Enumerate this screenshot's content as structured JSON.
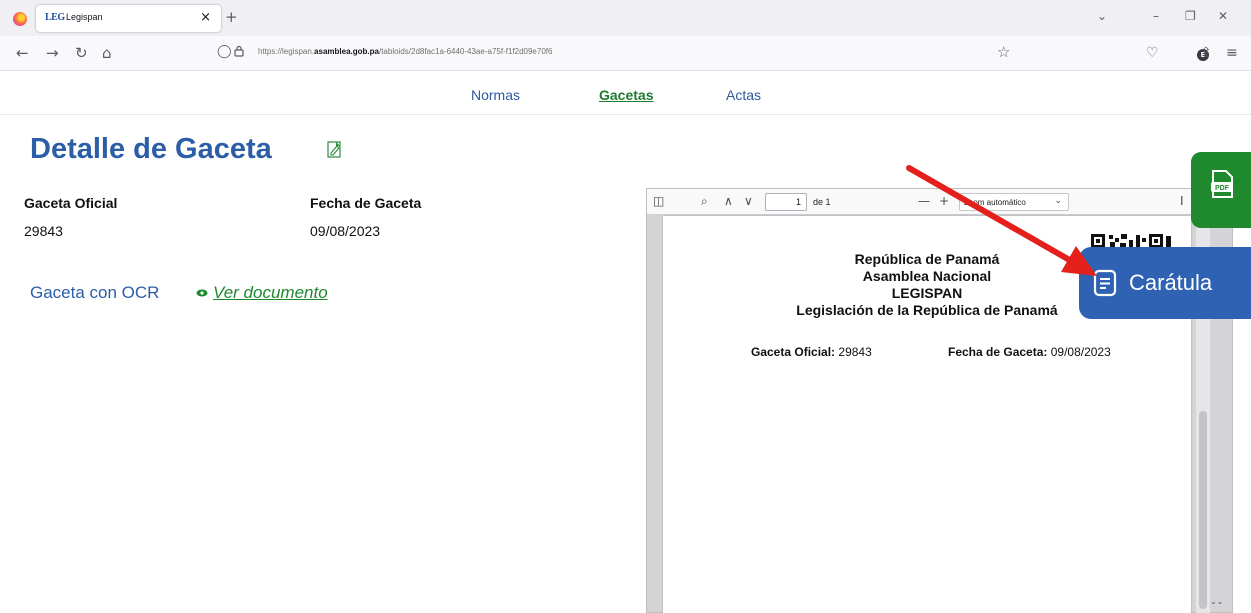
{
  "browser": {
    "tab_favicon": "LEG",
    "tab_title": "Legispan",
    "tab_close": "×",
    "new_tab": "+",
    "url_prefix": "https://legispan.",
    "url_host": "asamblea.gob.pa",
    "url_path": "/tabloids/2d8fac1a-6440-43ae-a75f-f1f2d09e70f6",
    "profile_initial": "E"
  },
  "site_nav": {
    "items": [
      {
        "label": "Normas",
        "active": false
      },
      {
        "label": "Gacetas",
        "active": true
      },
      {
        "label": "Actas",
        "active": false
      }
    ]
  },
  "page": {
    "title": "Detalle de Gaceta",
    "gaceta_label": "Gaceta Oficial",
    "gaceta_value": "29843",
    "fecha_label": "Fecha de Gaceta",
    "fecha_value": "09/08/2023",
    "ocr_label": "Gaceta con OCR",
    "ver_documento": "Ver documento"
  },
  "pdf_viewer": {
    "page_number": "1",
    "page_total": "de 1",
    "zoom_value": "Zoom automático",
    "document": {
      "line1": "República de Panamá",
      "line2": "Asamblea Nacional",
      "line3": "LEGISPAN",
      "line4": "Legislación de la República de Panamá",
      "gaceta_label": "Gaceta Oficial:",
      "gaceta_value": "29843",
      "fecha_label": "Fecha de Gaceta:",
      "fecha_value": "09/08/2023"
    }
  },
  "floating": {
    "pdf_button_label": "PDF",
    "caratula_label": "Carátula"
  },
  "colors": {
    "title_blue": "#2b5ea7",
    "link_green": "#1e8a2e",
    "fab_green": "#1f8a2d",
    "caratula_blue": "#2f62b3",
    "annotation_red": "#e3201b"
  }
}
